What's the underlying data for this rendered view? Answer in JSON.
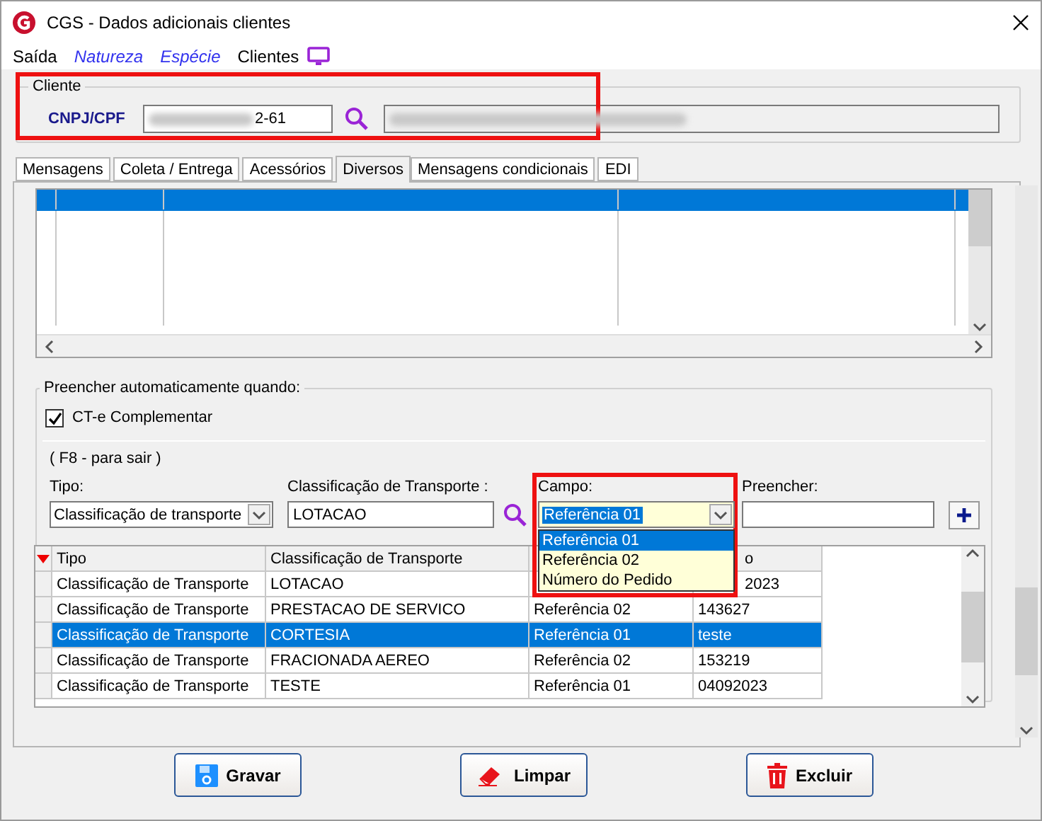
{
  "window": {
    "title": "CGS - Dados adicionais clientes"
  },
  "menu": [
    {
      "label": "Saída",
      "kind": "plain"
    },
    {
      "label": "Natureza",
      "kind": "link"
    },
    {
      "label": "Espécie",
      "kind": "link"
    },
    {
      "label": "Clientes",
      "kind": "plain"
    }
  ],
  "cliente": {
    "legend": "Cliente",
    "label": "CNPJ/CPF",
    "value": "2-61"
  },
  "tabs": [
    {
      "label": "Mensagens",
      "selected": false
    },
    {
      "label": "Coleta / Entrega",
      "selected": false
    },
    {
      "label": "Acessórios",
      "selected": false
    },
    {
      "label": "Diversos",
      "selected": true
    },
    {
      "label": "Mensagens condicionais",
      "selected": false
    },
    {
      "label": "EDI",
      "selected": false
    }
  ],
  "upper_grid": {
    "rows": [
      {
        "selected": true
      },
      {
        "selected": false
      }
    ]
  },
  "auto_fill": {
    "legend": "Preencher automaticamente quando:",
    "checkbox": {
      "label": "CT-e Complementar",
      "checked": true
    },
    "hint": "( F8 - para sair )",
    "tipo": {
      "label": "Tipo:",
      "value": "Classificação de transporte"
    },
    "classificacao": {
      "label": "Classificação de Transporte :",
      "value": "LOTACAO"
    },
    "campo": {
      "label": "Campo:",
      "value": "Referência 01",
      "options": [
        {
          "label": "Referência 01",
          "selected": true
        },
        {
          "label": "Referência 02",
          "selected": false
        },
        {
          "label": "Número do Pedido",
          "selected": false
        }
      ]
    },
    "preencher": {
      "label": "Preencher:"
    },
    "table": {
      "columns": [
        {
          "text": "Tipo"
        },
        {
          "text": "Classificação de Transporte"
        },
        {},
        {
          "text": "o",
          "covered": true
        }
      ],
      "rows": [
        {
          "selected": false,
          "cells": [
            {
              "text": "Classificação de Transporte"
            },
            {
              "text": "LOTACAO"
            },
            {},
            {
              "text": "2023",
              "covered": true
            }
          ]
        },
        {
          "selected": false,
          "cells": [
            {
              "text": "Classificação de Transporte"
            },
            {
              "text": "PRESTACAO DE SERVICO"
            },
            {
              "text": "Referência 02"
            },
            {
              "text": "143627"
            }
          ]
        },
        {
          "selected": true,
          "cells": [
            {
              "text": "Classificação de Transporte"
            },
            {
              "text": "CORTESIA"
            },
            {
              "text": "Referência 01"
            },
            {
              "text": "teste"
            }
          ]
        },
        {
          "selected": false,
          "cells": [
            {
              "text": "Classificação de Transporte"
            },
            {
              "text": "FRACIONADA AEREO"
            },
            {
              "text": "Referência 02"
            },
            {
              "text": "153219"
            }
          ]
        },
        {
          "selected": false,
          "cells": [
            {
              "text": "Classificação de Transporte"
            },
            {
              "text": "TESTE"
            },
            {
              "text": "Referência 01"
            },
            {
              "text": "04092023"
            }
          ]
        }
      ]
    }
  },
  "buttons": [
    {
      "label": "Gravar",
      "kind": "save"
    },
    {
      "label": "Limpar",
      "kind": "clear"
    },
    {
      "label": "Excluir",
      "kind": "delete"
    }
  ]
}
